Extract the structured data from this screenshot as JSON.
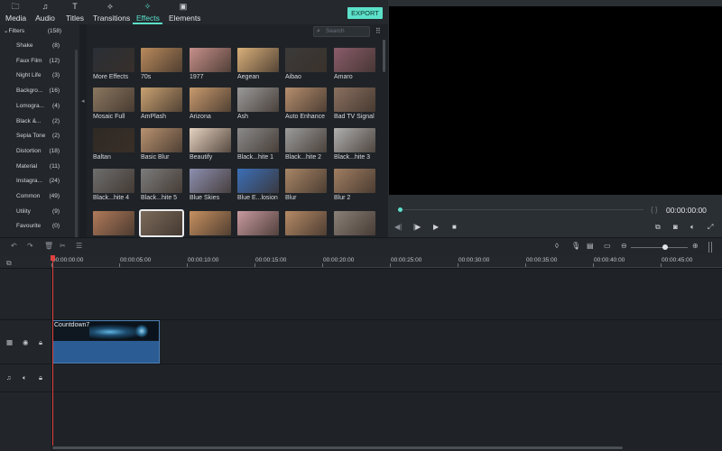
{
  "tabs": [
    {
      "label": "Media",
      "icon": "folder-icon",
      "glyph": "🗀",
      "active": false
    },
    {
      "label": "Audio",
      "icon": "music-note-icon",
      "glyph": "♫",
      "active": false
    },
    {
      "label": "Titles",
      "icon": "text-icon",
      "glyph": "T",
      "active": false
    },
    {
      "label": "Transitions",
      "icon": "transition-icon",
      "glyph": "⟡",
      "active": false
    },
    {
      "label": "Effects",
      "icon": "effects-icon",
      "glyph": "✧",
      "active": true
    },
    {
      "label": "Elements",
      "icon": "image-icon",
      "glyph": "▣",
      "active": false
    }
  ],
  "export_label": "EXPORT",
  "sidebar": {
    "root": {
      "label": "Filters",
      "count": "(158)"
    },
    "items": [
      {
        "label": "Shake",
        "count": "(8)"
      },
      {
        "label": "Faux Film",
        "count": "(12)"
      },
      {
        "label": "Night Life",
        "count": "(3)"
      },
      {
        "label": "Backgro...",
        "count": "(16)"
      },
      {
        "label": "Lomogra...",
        "count": "(4)"
      },
      {
        "label": "Black &...",
        "count": "(2)"
      },
      {
        "label": "Sepia Tone",
        "count": "(2)"
      },
      {
        "label": "Distortion",
        "count": "(18)"
      },
      {
        "label": "Material",
        "count": "(11)"
      },
      {
        "label": "Instagra...",
        "count": "(24)"
      },
      {
        "label": "Common",
        "count": "(49)"
      },
      {
        "label": "Utility",
        "count": "(9)"
      },
      {
        "label": "Favourite",
        "count": "(0)"
      }
    ]
  },
  "search": {
    "placeholder": "Search"
  },
  "effects": [
    {
      "label": "More Effects",
      "color": "#2a2f36",
      "selected": false
    },
    {
      "label": "70s",
      "color": "#b98a5c",
      "selected": false
    },
    {
      "label": "1977",
      "color": "#c7908a",
      "selected": false
    },
    {
      "label": "Aegean",
      "color": "#d9b07a",
      "selected": false
    },
    {
      "label": "Aibao",
      "color": "#3b3a3a",
      "selected": false
    },
    {
      "label": "Amaro",
      "color": "#8a5c6c",
      "selected": false
    },
    {
      "label": "Mosaic Full",
      "color": "#8b7760",
      "selected": false
    },
    {
      "label": "AmPlash",
      "color": "#c9a171",
      "selected": false
    },
    {
      "label": "Arizona",
      "color": "#c89a6e",
      "selected": false
    },
    {
      "label": "Ash",
      "color": "#9a9a9a",
      "selected": false
    },
    {
      "label": "Auto Enhance",
      "color": "#b58e6e",
      "selected": false
    },
    {
      "label": "Bad TV Signal",
      "color": "#8a7060",
      "selected": false
    },
    {
      "label": "Baltan",
      "color": "#2f2a24",
      "selected": false
    },
    {
      "label": "Basic Blur",
      "color": "#b89270",
      "selected": false
    },
    {
      "label": "Beautify",
      "color": "#e6d2c0",
      "selected": false
    },
    {
      "label": "Black...hite 1",
      "color": "#8a8a8a",
      "selected": false
    },
    {
      "label": "Black...hite 2",
      "color": "#9c9c9c",
      "selected": false
    },
    {
      "label": "Black...hite 3",
      "color": "#b0b0b0",
      "selected": false
    },
    {
      "label": "Black...hite 4",
      "color": "#6e6e6e",
      "selected": false
    },
    {
      "label": "Black...hite 5",
      "color": "#7c7c7c",
      "selected": false
    },
    {
      "label": "Blue Skies",
      "color": "#8c8fb0",
      "selected": false
    },
    {
      "label": "Blue E...losion",
      "color": "#3b6fb8",
      "selected": false
    },
    {
      "label": "Blur",
      "color": "#a88666",
      "selected": false
    },
    {
      "label": "Blur 2",
      "color": "#a07e62",
      "selected": false
    },
    {
      "label": "",
      "color": "#b07a5a",
      "selected": false
    },
    {
      "label": "",
      "color": "#7a6a5a",
      "selected": true
    },
    {
      "label": "",
      "color": "#c69060",
      "selected": false
    },
    {
      "label": "",
      "color": "#c89aa0",
      "selected": false
    },
    {
      "label": "",
      "color": "#b58a66",
      "selected": false
    },
    {
      "label": "",
      "color": "#8a8078",
      "selected": false
    }
  ],
  "preview": {
    "timecode": "00:00:00:00",
    "braces": "{ }"
  },
  "ruler": {
    "ticks": [
      "00:00:00:00",
      "00:00:05:00",
      "00:00:10:00",
      "00:00:15:00",
      "00:00:20:00",
      "00:00:25:00",
      "00:00:30:00",
      "00:00:35:00",
      "00:00:40:00",
      "00:00:45:00"
    ]
  },
  "clip": {
    "name": "Countdown7"
  }
}
